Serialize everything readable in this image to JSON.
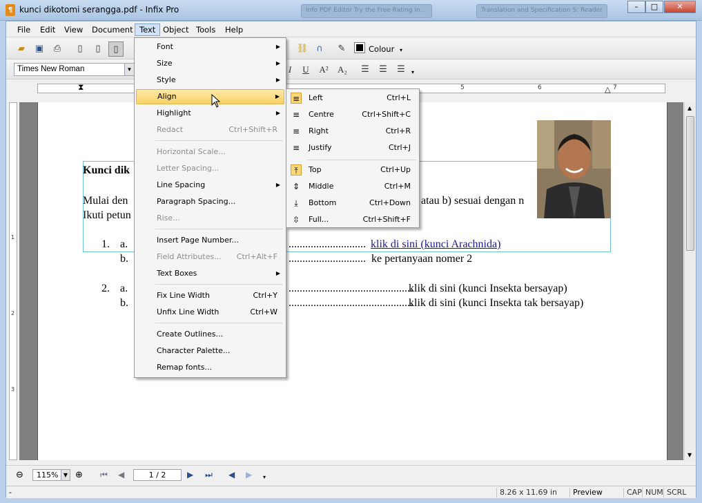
{
  "window": {
    "title": "kunci dikotomi serangga.pdf - Infix Pro",
    "bg_tab1": "Info PDF Editor Try the Free Rating in...",
    "bg_tab2": "Translation and Specification S: Reader",
    "minimize": "–",
    "maximize": "□",
    "close": "✕"
  },
  "menubar": {
    "items": [
      "File",
      "Edit",
      "View",
      "Document",
      "Text",
      "Object",
      "Tools",
      "Help"
    ]
  },
  "toolbar": {
    "font_name": "Times New Roman",
    "colour_label": "Colour"
  },
  "ruler": {
    "h_numbers": [
      "5",
      "6",
      "7"
    ],
    "v_numbers": [
      "1",
      "2",
      "3"
    ]
  },
  "document": {
    "heading": "Kunci dik",
    "line1_left": "Mulai den",
    "line1_right": "atau b) sesuai dengan n",
    "line2_left": "Ikuti petun",
    "item1_num": "1.",
    "item1a_label": "a.",
    "item1a_dots": "............................",
    "item1a_link": "klik di sini (kunci Arachnida)",
    "item1b_label": "b.",
    "item1b_dots": "............................",
    "item1b_text": "ke pertanyaan nomer 2",
    "item2_num": "2.",
    "item2a_label": "a.",
    "item2a_dots": ".............................................",
    "item2a_text": "klik di sini (kunci Insekta bersayap)",
    "item2b_label": "b.",
    "item2b_dots": ".............................................",
    "item2b_text": "klik di sini (kunci Insekta tak bersayap)"
  },
  "text_menu": {
    "items": [
      {
        "label": "Font",
        "shortcut": "",
        "submenu": true,
        "disabled": false
      },
      {
        "label": "Size",
        "shortcut": "",
        "submenu": true,
        "disabled": false
      },
      {
        "label": "Style",
        "shortcut": "",
        "submenu": true,
        "disabled": false
      },
      {
        "label": "Align",
        "shortcut": "",
        "submenu": true,
        "disabled": false
      },
      {
        "label": "Highlight",
        "shortcut": "",
        "submenu": true,
        "disabled": false
      },
      {
        "label": "Redact",
        "shortcut": "Ctrl+Shift+R",
        "submenu": false,
        "disabled": true
      },
      {
        "label": "Horizontal Scale...",
        "shortcut": "",
        "submenu": false,
        "disabled": true
      },
      {
        "label": "Letter Spacing...",
        "shortcut": "",
        "submenu": false,
        "disabled": true
      },
      {
        "label": "Line Spacing",
        "shortcut": "",
        "submenu": true,
        "disabled": false
      },
      {
        "label": "Paragraph Spacing...",
        "shortcut": "",
        "submenu": false,
        "disabled": false
      },
      {
        "label": "Rise...",
        "shortcut": "",
        "submenu": false,
        "disabled": true
      },
      {
        "label": "Insert Page Number...",
        "shortcut": "",
        "submenu": false,
        "disabled": false
      },
      {
        "label": "Field Attributes...",
        "shortcut": "Ctrl+Alt+F",
        "submenu": false,
        "disabled": true
      },
      {
        "label": "Text Boxes",
        "shortcut": "",
        "submenu": true,
        "disabled": false
      },
      {
        "label": "Fix Line Width",
        "shortcut": "Ctrl+Y",
        "submenu": false,
        "disabled": false
      },
      {
        "label": "Unfix Line Width",
        "shortcut": "Ctrl+W",
        "submenu": false,
        "disabled": false
      },
      {
        "label": "Create Outlines...",
        "shortcut": "",
        "submenu": false,
        "disabled": false
      },
      {
        "label": "Character Palette...",
        "shortcut": "",
        "submenu": false,
        "disabled": false
      },
      {
        "label": "Remap fonts...",
        "shortcut": "",
        "submenu": false,
        "disabled": false
      }
    ]
  },
  "align_menu": {
    "items": [
      {
        "label": "Left",
        "shortcut": "Ctrl+L",
        "icon": "align-left-icon"
      },
      {
        "label": "Centre",
        "shortcut": "Ctrl+Shift+C",
        "icon": "align-centre-icon"
      },
      {
        "label": "Right",
        "shortcut": "Ctrl+R",
        "icon": "align-right-icon"
      },
      {
        "label": "Justify",
        "shortcut": "Ctrl+J",
        "icon": "align-justify-icon"
      },
      {
        "label": "Top",
        "shortcut": "Ctrl+Up",
        "icon": "align-top-icon"
      },
      {
        "label": "Middle",
        "shortcut": "Ctrl+M",
        "icon": "align-middle-icon"
      },
      {
        "label": "Bottom",
        "shortcut": "Ctrl+Down",
        "icon": "align-bottom-icon"
      },
      {
        "label": "Full...",
        "shortcut": "Ctrl+Shift+F",
        "icon": "align-full-icon"
      }
    ]
  },
  "navbar": {
    "zoom": "115%",
    "page": "1 / 2"
  },
  "statusbar": {
    "left": "-",
    "page_size": "8.26 x 11.69 in",
    "mode": "Preview",
    "cap": "CAP",
    "num": "NUM",
    "scrl": "SCRL"
  }
}
